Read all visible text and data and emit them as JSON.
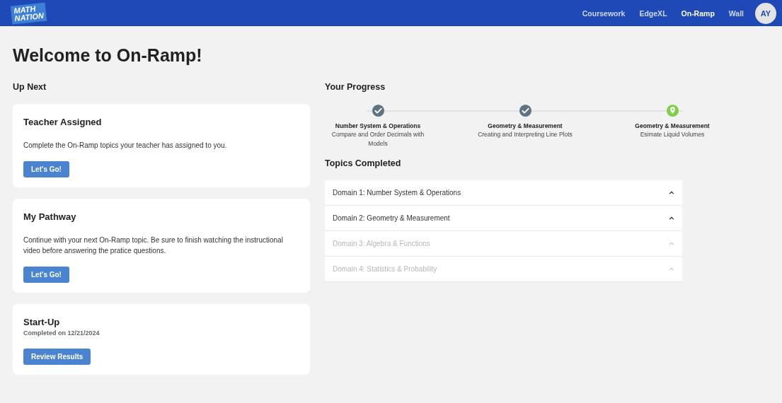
{
  "nav": {
    "logo": [
      "MATH",
      "NATION"
    ],
    "links": [
      {
        "label": "Coursework",
        "selected": false
      },
      {
        "label": "EdgeXL",
        "selected": false
      },
      {
        "label": "On-Ramp",
        "selected": true
      },
      {
        "label": "Wall",
        "selected": false
      }
    ],
    "avatar": "AY"
  },
  "title": "Welcome to On-Ramp!",
  "up_next": {
    "heading": "Up Next",
    "cards": [
      {
        "title": "Teacher Assigned",
        "text": "Complete the On-Ramp topics your teacher has assigned to you.",
        "button": "Let's Go!"
      },
      {
        "title": "My Pathway",
        "text": "Continue with your next On-Ramp topic. Be sure to finish watching the instructional video before answering the pratice questions.",
        "button": "Let's Go!"
      },
      {
        "title": "Start-Up",
        "subtitle": "Completed on 12/21/2024",
        "button": "Review Results"
      }
    ]
  },
  "progress": {
    "heading": "Your Progress",
    "steps": [
      {
        "domain": "Number System & Operations",
        "topic": "Compare and Order Decimals with Models",
        "kind": "done"
      },
      {
        "domain": "Geometry & Measurement",
        "topic": "Creating and Interpreting Line Plots",
        "kind": "done"
      },
      {
        "domain": "Geometry & Measurement",
        "topic": "Esimate Liquid Volumes",
        "kind": "current"
      }
    ]
  },
  "topics_completed": {
    "heading": "Topics Completed",
    "domains": [
      {
        "label": "Domain 1: Number System & Operations",
        "disabled": false
      },
      {
        "label": "Domain 2: Geometry & Measurement",
        "disabled": false
      },
      {
        "label": "Domain 3: Algebra & Functions",
        "disabled": true
      },
      {
        "label": "Domain 4: Statistics & Probability",
        "disabled": true
      }
    ]
  }
}
